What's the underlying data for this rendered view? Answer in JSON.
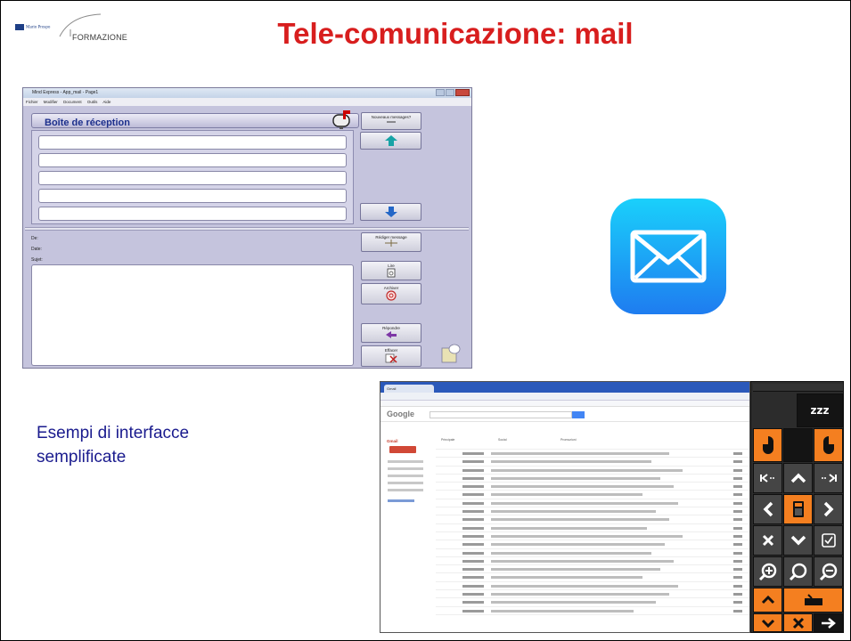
{
  "slide": {
    "title": "Tele-comunicazione: mail",
    "caption_line1": "Esempi di interfacce",
    "caption_line2": "semplificate"
  },
  "logo": {
    "brand_text": "Mario Prospo",
    "formazione": "FORMAZIONE"
  },
  "mind_express": {
    "window_title": "Mind Express - App_mail - Page1",
    "menu": [
      "Fichier",
      "Modifier",
      "Document",
      "Outils",
      "Aide"
    ],
    "inbox_title": "Boîte de réception",
    "new_messages_label": "Nouveaux messages?",
    "fields": {
      "from": "De:",
      "date": "Date:",
      "subject": "Sujet:"
    },
    "buttons": {
      "compose": "Rédiger message",
      "read": "Lire",
      "archive": "Archiver",
      "reply": "Répondre",
      "delete": "Effacer"
    }
  },
  "gmail": {
    "tab_label": "Gmail",
    "logo": "Google",
    "mail_label": "Gmail",
    "categories": [
      "Principale",
      "Social",
      "Promozioni"
    ]
  },
  "colors": {
    "title_red": "#d81e1e",
    "caption_blue": "#1a1b8e",
    "mx_bg": "#c5c4dd",
    "inbox_blue": "#1c2f8c",
    "ios_top": "#1ad0fb",
    "ios_bottom": "#1e7cf0",
    "kb_orange": "#f47f20",
    "kb_dark": "#454545"
  },
  "icons": {
    "mailbox": "mailbox-icon",
    "up": "up-arrow-icon",
    "down": "down-arrow-icon",
    "ios_mail": "envelope-icon",
    "sleep": "zzz-icon"
  },
  "keyboard": {
    "sleep_label": "zzz"
  }
}
